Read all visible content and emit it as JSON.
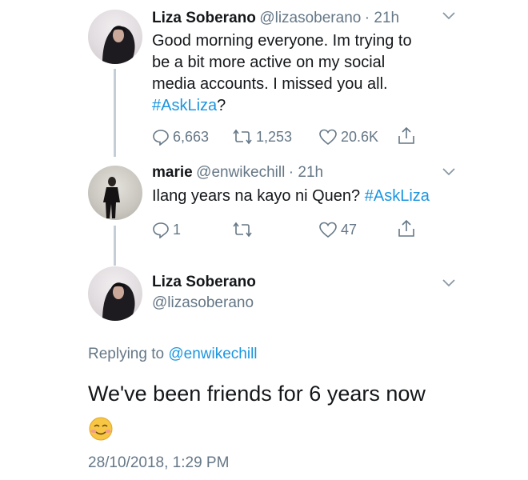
{
  "tweet1": {
    "name": "Liza Soberano",
    "handle": "@lizasoberano",
    "time": "· 21h",
    "text_lines": [
      "Good morning everyone. Im trying to",
      "be a bit more active on my social",
      "media accounts. I missed you all."
    ],
    "hashtag": "#AskLiza",
    "trailing": "?",
    "replies": "6,663",
    "retweets": "1,253",
    "likes": "20.6K"
  },
  "tweet2": {
    "name": "marie",
    "handle": "@enwikechill",
    "time": "· 21h",
    "text": "Ilang years na kayo ni Quen?",
    "hashtag": "#AskLiza",
    "replies": "1",
    "retweets": "",
    "likes": "47"
  },
  "main": {
    "name": "Liza Soberano",
    "handle": "@lizasoberano",
    "replying_prefix": "Replying to",
    "replying_handle": "@enwikechill",
    "text": "We've been friends for 6 years now",
    "emoji": "☺️",
    "timestamp": "28/10/2018, 1:29 PM"
  },
  "colors": {
    "link": "#1b95e0",
    "secondary": "#657786",
    "thread_line": "#c5ced6"
  }
}
